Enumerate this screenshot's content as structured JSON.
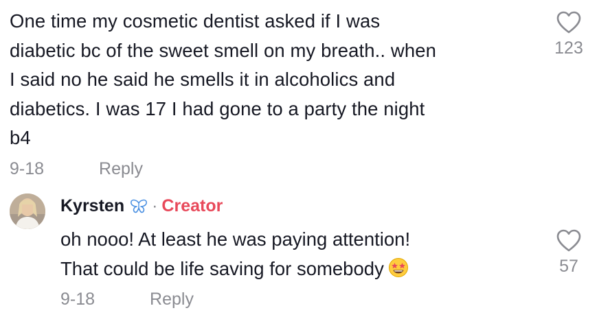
{
  "comment": {
    "lines": [
      "One time my cosmetic dentist asked if I was",
      "diabetic bc of the sweet smell on my breath.. when",
      "I said no he said he smells it in alcoholics and",
      "diabetics. I was 17 I had gone to a party the night",
      "b4"
    ],
    "date": "9-18",
    "reply_label": "Reply",
    "like_count": "123",
    "like_icon": "heart-outline-icon"
  },
  "reply": {
    "username": "Kyrsten",
    "badge_icon": "butterfly-icon",
    "separator": "·",
    "creator_label": "Creator",
    "creator_color": "#e8495a",
    "lines": [
      "oh nooo! At least he was paying attention!",
      "That could be life saving for somebody"
    ],
    "emoji_icon": "star-struck-emoji-icon",
    "date": "9-18",
    "reply_label": "Reply",
    "like_count": "57",
    "like_icon": "heart-outline-icon"
  },
  "colors": {
    "text": "#161823",
    "muted": "#8a8b91",
    "creator": "#e8495a",
    "butterfly": "#4a90e2"
  }
}
